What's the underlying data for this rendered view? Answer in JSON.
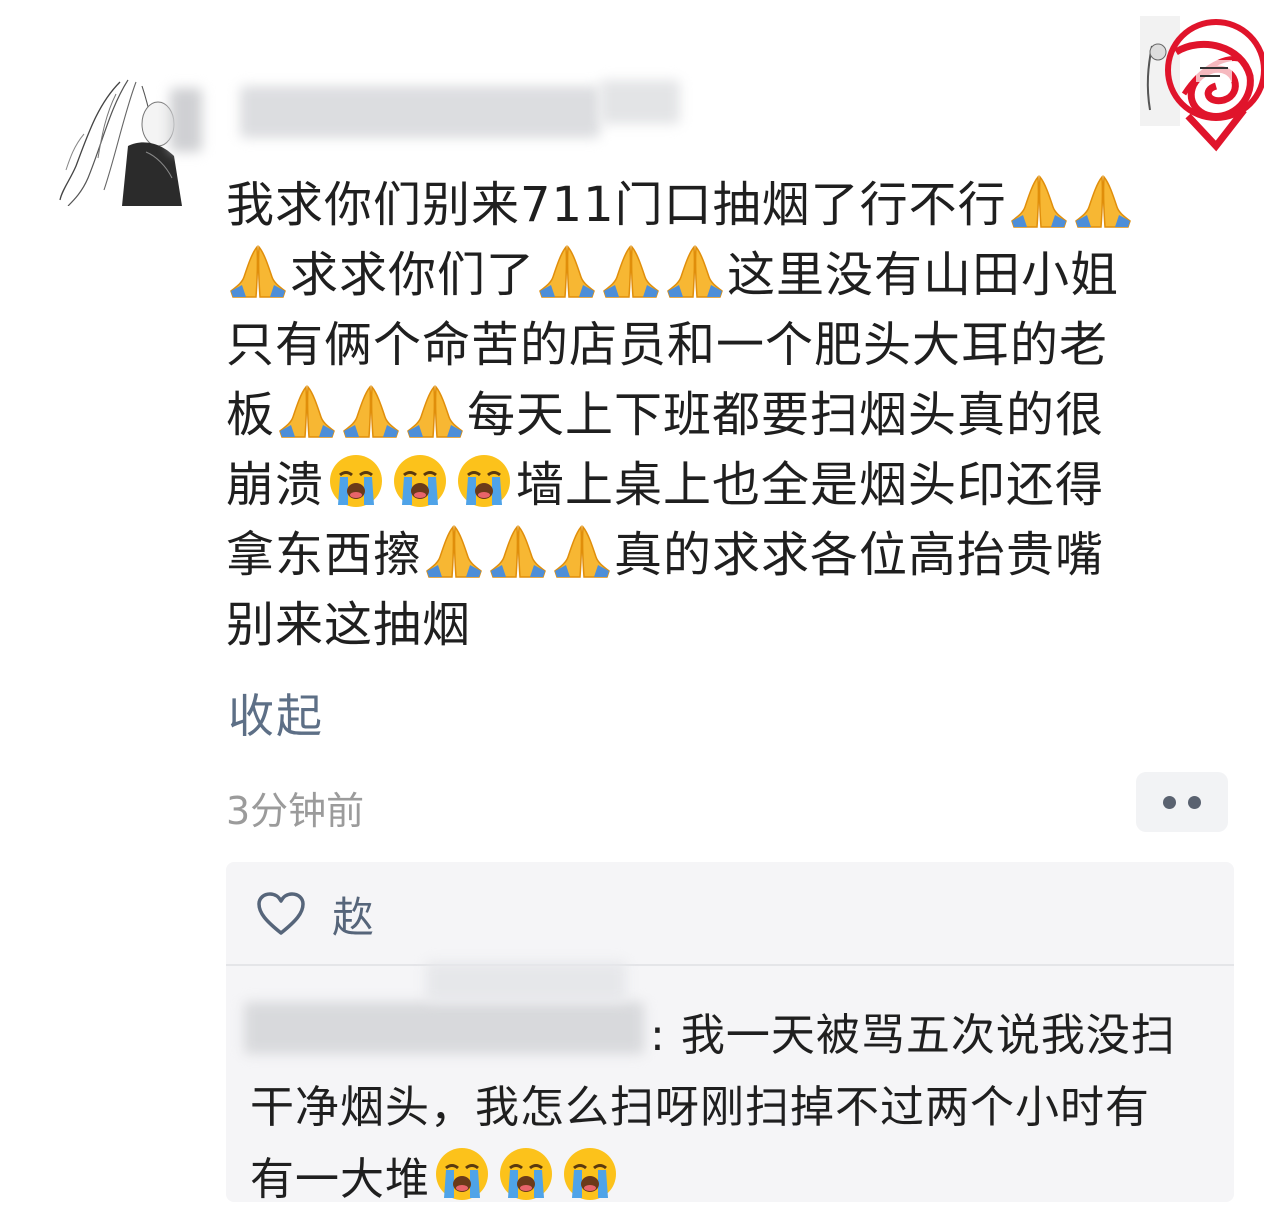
{
  "post": {
    "lines": [
      "我求你们别来711门口抽烟了行不行",
      "求求你们了",
      "这里没有山田小姐",
      "只有俩个命苦的店员和一个肥头大耳的老",
      "板",
      "每天上下班都要扫烟头真的很",
      "崩溃",
      "墙上桌上也全是烟头印还得",
      "拿东西擦",
      "真的求求各位高抬贵嘴",
      "别来这抽烟"
    ],
    "collapse_label": "收起",
    "timestamp": "3分钟前"
  },
  "actions": {
    "like_label": "赼"
  },
  "comment": {
    "separator": ":",
    "line1": " 我一天被骂五次说我没扫",
    "line2": "干净烟头，我怎么扫呀刚扫掉不过两个小时有",
    "line3": "有一大堆"
  },
  "icons": {
    "avatar": "anime-girl-avatar",
    "emoji_pray": "folded-hands-icon",
    "emoji_cry": "loudly-crying-face-icon",
    "like": "heart-outline-icon",
    "more": "more-dots-icon",
    "stamp": "scribbled-out-stamp"
  },
  "colors": {
    "collapse_link": "#5d6f86",
    "timestamp": "#9b9b9b",
    "panel_bg": "#f5f5f7",
    "stamp_red": "#e0142b"
  }
}
